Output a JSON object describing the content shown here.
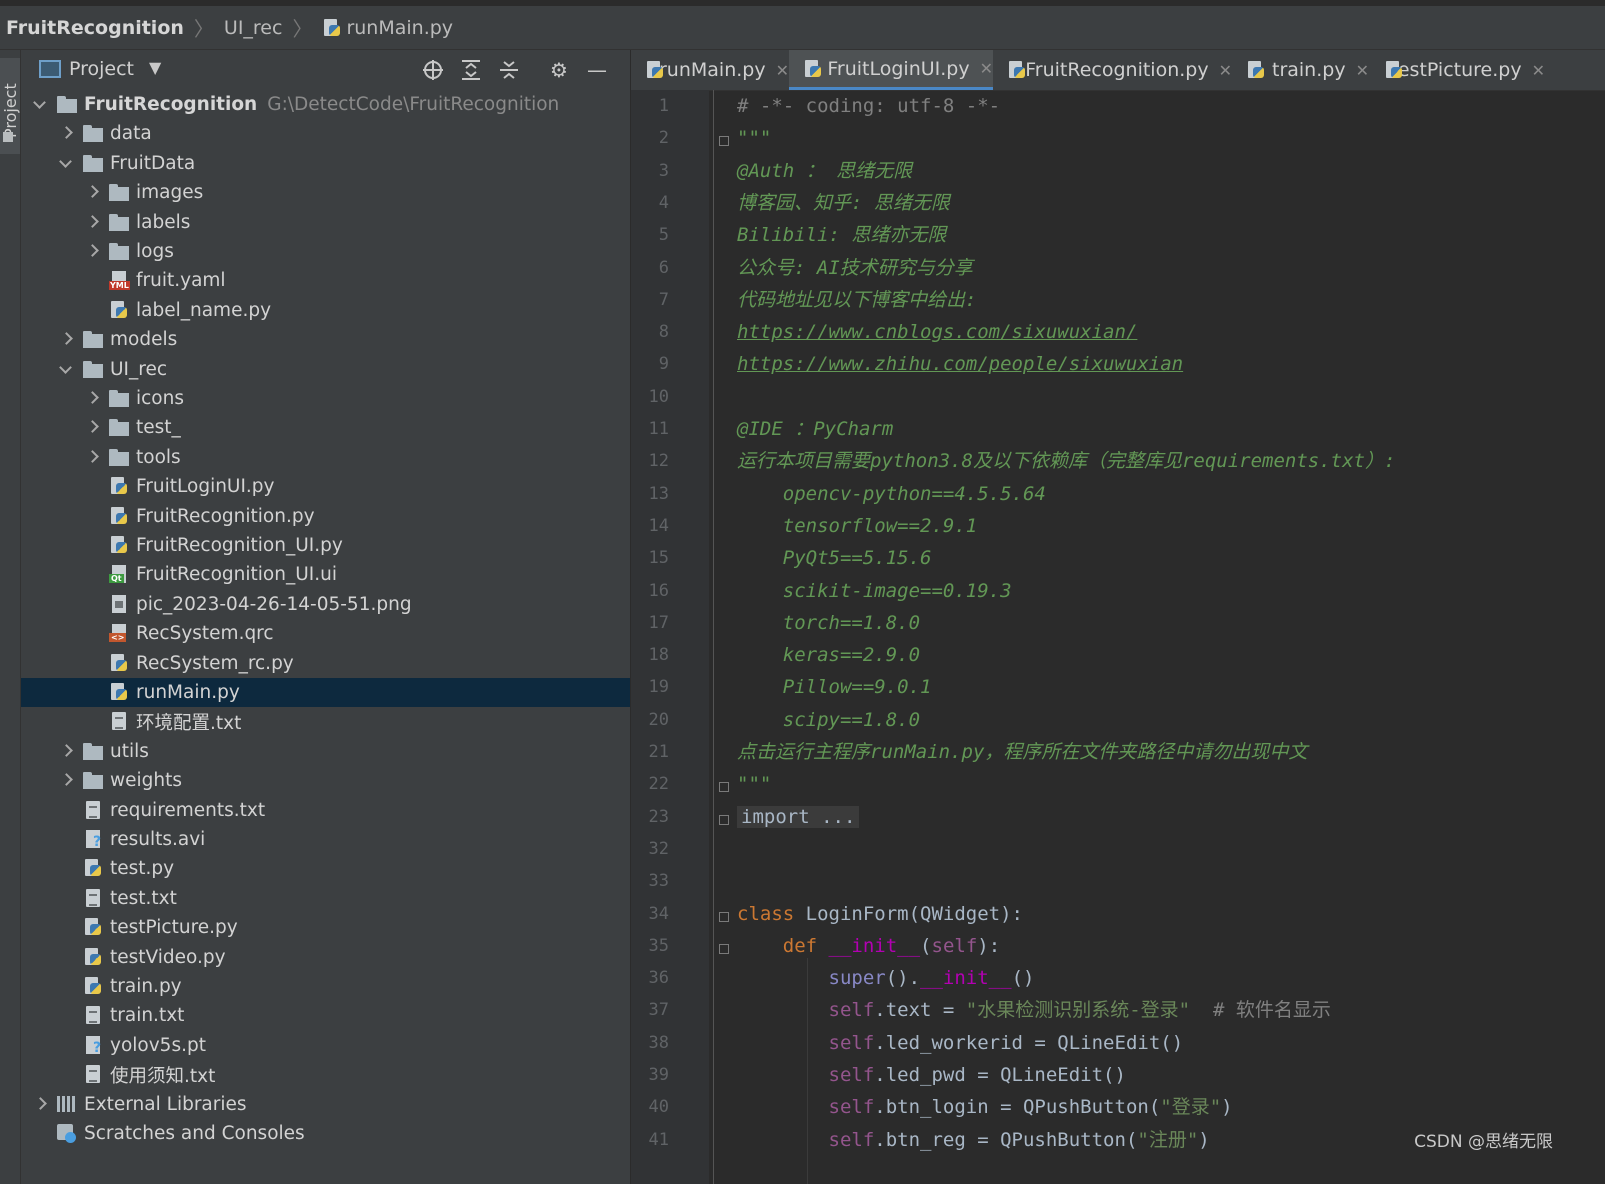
{
  "breadcrumb": {
    "root": "FruitRecognition",
    "folder": "UI_rec",
    "file": "runMain.py"
  },
  "side_strip": {
    "tab_label": "Project"
  },
  "project_panel": {
    "title": "Project",
    "root_name": "FruitRecognition",
    "root_path": "G:\\DetectCode\\FruitRecognition",
    "items": [
      {
        "label": "data",
        "type": "folder",
        "depth": 1,
        "expanded": false
      },
      {
        "label": "FruitData",
        "type": "folder",
        "depth": 1,
        "expanded": true
      },
      {
        "label": "images",
        "type": "folder",
        "depth": 2,
        "expanded": false
      },
      {
        "label": "labels",
        "type": "folder",
        "depth": 2,
        "expanded": false
      },
      {
        "label": "logs",
        "type": "folder",
        "depth": 2,
        "expanded": false
      },
      {
        "label": "fruit.yaml",
        "type": "yaml",
        "depth": 2
      },
      {
        "label": "label_name.py",
        "type": "py",
        "depth": 2
      },
      {
        "label": "models",
        "type": "folder",
        "depth": 1,
        "expanded": false
      },
      {
        "label": "UI_rec",
        "type": "folder",
        "depth": 1,
        "expanded": true
      },
      {
        "label": "icons",
        "type": "folder",
        "depth": 2,
        "expanded": false
      },
      {
        "label": "test_",
        "type": "folder",
        "depth": 2,
        "expanded": false
      },
      {
        "label": "tools",
        "type": "folder",
        "depth": 2,
        "expanded": false
      },
      {
        "label": "FruitLoginUI.py",
        "type": "py",
        "depth": 2
      },
      {
        "label": "FruitRecognition.py",
        "type": "py",
        "depth": 2
      },
      {
        "label": "FruitRecognition_UI.py",
        "type": "py",
        "depth": 2
      },
      {
        "label": "FruitRecognition_UI.ui",
        "type": "qt",
        "depth": 2
      },
      {
        "label": "pic_2023-04-26-14-05-51.png",
        "type": "png",
        "depth": 2
      },
      {
        "label": "RecSystem.qrc",
        "type": "qrc",
        "depth": 2
      },
      {
        "label": "RecSystem_rc.py",
        "type": "py",
        "depth": 2
      },
      {
        "label": "runMain.py",
        "type": "py",
        "depth": 2,
        "selected": true
      },
      {
        "label": "环境配置.txt",
        "type": "txt",
        "depth": 2
      },
      {
        "label": "utils",
        "type": "folder",
        "depth": 1,
        "expanded": false
      },
      {
        "label": "weights",
        "type": "folder",
        "depth": 1,
        "expanded": false
      },
      {
        "label": "requirements.txt",
        "type": "txt",
        "depth": 1
      },
      {
        "label": "results.avi",
        "type": "unk",
        "depth": 1
      },
      {
        "label": "test.py",
        "type": "py",
        "depth": 1
      },
      {
        "label": "test.txt",
        "type": "txt",
        "depth": 1
      },
      {
        "label": "testPicture.py",
        "type": "py",
        "depth": 1
      },
      {
        "label": "testVideo.py",
        "type": "py",
        "depth": 1
      },
      {
        "label": "train.py",
        "type": "py",
        "depth": 1
      },
      {
        "label": "train.txt",
        "type": "txt",
        "depth": 1
      },
      {
        "label": "yolov5s.pt",
        "type": "unk",
        "depth": 1
      },
      {
        "label": "使用须知.txt",
        "type": "txt",
        "depth": 1
      },
      {
        "label": "External Libraries",
        "type": "lib",
        "depth": 0,
        "expanded": false
      },
      {
        "label": "Scratches and Consoles",
        "type": "scratch",
        "depth": 0
      }
    ]
  },
  "editor_tabs": [
    {
      "label": "runMain.py",
      "active": false
    },
    {
      "label": "FruitLoginUI.py",
      "active": true
    },
    {
      "label": "FruitRecognition.py",
      "active": false
    },
    {
      "label": "train.py",
      "active": false
    },
    {
      "label": "testPicture.py",
      "active": false
    }
  ],
  "code_lines": [
    {
      "n": "1",
      "segs": [
        [
          "cmt",
          "# -*- coding: utf-8 -*-"
        ]
      ]
    },
    {
      "n": "2",
      "segs": [
        [
          "doc",
          "\"\"\""
        ]
      ],
      "fold": true
    },
    {
      "n": "3",
      "segs": [
        [
          "doc",
          "@Auth ： 思绪无限"
        ]
      ]
    },
    {
      "n": "4",
      "segs": [
        [
          "doc",
          "博客园、知乎: 思绪无限"
        ]
      ]
    },
    {
      "n": "5",
      "segs": [
        [
          "doc",
          "Bilibili: 思绪亦无限"
        ]
      ]
    },
    {
      "n": "6",
      "segs": [
        [
          "doc",
          "公众号: AI技术研究与分享"
        ]
      ]
    },
    {
      "n": "7",
      "segs": [
        [
          "doc",
          "代码地址见以下博客中给出:"
        ]
      ]
    },
    {
      "n": "8",
      "segs": [
        [
          "doc-link",
          "https://www.cnblogs.com/sixuwuxian/"
        ]
      ]
    },
    {
      "n": "9",
      "segs": [
        [
          "doc-link",
          "https://www.zhihu.com/people/sixuwuxian"
        ]
      ]
    },
    {
      "n": "10",
      "segs": []
    },
    {
      "n": "11",
      "segs": [
        [
          "doc",
          "@IDE ：PyCharm"
        ]
      ]
    },
    {
      "n": "12",
      "segs": [
        [
          "doc",
          "运行本项目需要python3.8及以下依赖库（完整库见requirements.txt）:"
        ]
      ]
    },
    {
      "n": "13",
      "segs": [
        [
          "doc",
          "    opencv-python==4.5.5.64"
        ]
      ]
    },
    {
      "n": "14",
      "segs": [
        [
          "doc",
          "    tensorflow==2.9.1"
        ]
      ]
    },
    {
      "n": "15",
      "segs": [
        [
          "doc",
          "    PyQt5==5.15.6"
        ]
      ]
    },
    {
      "n": "16",
      "segs": [
        [
          "doc",
          "    scikit-image==0.19.3"
        ]
      ]
    },
    {
      "n": "17",
      "segs": [
        [
          "doc",
          "    torch==1.8.0"
        ]
      ]
    },
    {
      "n": "18",
      "segs": [
        [
          "doc",
          "    keras==2.9.0"
        ]
      ]
    },
    {
      "n": "19",
      "segs": [
        [
          "doc",
          "    Pillow==9.0.1"
        ]
      ]
    },
    {
      "n": "20",
      "segs": [
        [
          "doc",
          "    scipy==1.8.0"
        ]
      ]
    },
    {
      "n": "21",
      "segs": [
        [
          "doc",
          "点击运行主程序runMain.py，程序所在文件夹路径中请勿出现中文"
        ]
      ]
    },
    {
      "n": "22",
      "segs": [
        [
          "doc",
          "\"\"\""
        ]
      ],
      "fold": true
    },
    {
      "n": "23",
      "segs": [
        [
          "fold-imp",
          "import ..."
        ]
      ],
      "fold": true
    },
    {
      "n": "32",
      "segs": []
    },
    {
      "n": "33",
      "segs": []
    },
    {
      "n": "34",
      "segs": [
        [
          "kw",
          "class "
        ],
        [
          "plain",
          "LoginForm(QWidget):"
        ]
      ],
      "fold": true
    },
    {
      "n": "35",
      "segs": [
        [
          "plain",
          "    "
        ],
        [
          "kw",
          "def "
        ],
        [
          "magic",
          "__init__"
        ],
        [
          "plain",
          "("
        ],
        [
          "self",
          "self"
        ],
        [
          "plain",
          "):"
        ]
      ],
      "fold": true
    },
    {
      "n": "36",
      "segs": [
        [
          "plain",
          "        "
        ],
        [
          "magic2",
          "super"
        ],
        [
          "plain",
          "()."
        ],
        [
          "magic",
          "__init__"
        ],
        [
          "plain",
          "()"
        ]
      ]
    },
    {
      "n": "37",
      "segs": [
        [
          "plain",
          "        "
        ],
        [
          "self",
          "self"
        ],
        [
          "plain",
          ".text = "
        ],
        [
          "str",
          "\"水果检测识别系统-登录\""
        ],
        [
          "plain",
          "  "
        ],
        [
          "cmt",
          "# 软件名显示"
        ]
      ]
    },
    {
      "n": "38",
      "segs": [
        [
          "plain",
          "        "
        ],
        [
          "self",
          "self"
        ],
        [
          "plain",
          ".led_workerid = QLineEdit()"
        ]
      ]
    },
    {
      "n": "39",
      "segs": [
        [
          "plain",
          "        "
        ],
        [
          "self",
          "self"
        ],
        [
          "plain",
          ".led_pwd = QLineEdit()"
        ]
      ]
    },
    {
      "n": "40",
      "segs": [
        [
          "plain",
          "        "
        ],
        [
          "self",
          "self"
        ],
        [
          "plain",
          ".btn_login = QPushButton("
        ],
        [
          "str",
          "\"登录\""
        ],
        [
          "plain",
          ")"
        ]
      ]
    },
    {
      "n": "41",
      "segs": [
        [
          "plain",
          "        "
        ],
        [
          "self",
          "self"
        ],
        [
          "plain",
          ".btn_reg = QPushButton("
        ],
        [
          "str",
          "\"注册\""
        ],
        [
          "plain",
          ")"
        ]
      ]
    }
  ],
  "watermark": "CSDN @思绪无限"
}
